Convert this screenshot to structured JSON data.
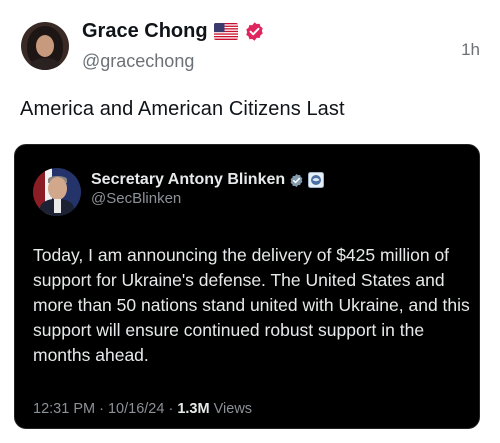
{
  "author": {
    "name": "Grace Chong",
    "handle": "@gracechong",
    "time": "1h"
  },
  "post": {
    "text": "America and American Citizens Last"
  },
  "quoted": {
    "name": "Secretary Antony Blinken",
    "handle": "@SecBlinken",
    "body": "Today, I am announcing the delivery of $425 million of support for Ukraine's defense. The United States and more than 50 nations stand united with Ukraine, and this support will ensure continued robust support in the months ahead.",
    "time": "12:31 PM",
    "separator": "·",
    "date": "10/16/24",
    "views_count": "1.3M",
    "views_label": "Views"
  },
  "colors": {
    "verified_pink": "#e0245e",
    "verified_gray": "#829aab",
    "card_bg": "#000000",
    "muted": "#6b7177"
  },
  "icons": [
    "us-flag-icon",
    "verified-badge-icon",
    "verified-gray-badge-icon",
    "government-seal-icon"
  ]
}
